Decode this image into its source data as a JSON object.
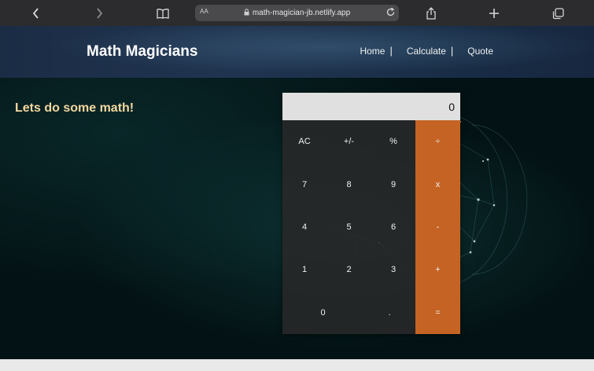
{
  "browser": {
    "text_size_label": "AA",
    "url": "math-magician-jb.netlify.app"
  },
  "header": {
    "logo": "Math Magicians",
    "nav": [
      {
        "label": "Home",
        "separator": "|"
      },
      {
        "label": "Calculate",
        "separator": "|"
      },
      {
        "label": "Quote",
        "separator": ""
      }
    ]
  },
  "main": {
    "heading": "Lets do some math!"
  },
  "calculator": {
    "display": "0",
    "keys": {
      "ac": "AC",
      "sign": "+/-",
      "percent": "%",
      "divide": "÷",
      "seven": "7",
      "eight": "8",
      "nine": "9",
      "multiply": "x",
      "four": "4",
      "five": "5",
      "six": "6",
      "minus": "-",
      "one": "1",
      "two": "2",
      "three": "3",
      "plus": "+",
      "zero": "0",
      "dot": ".",
      "equals": "="
    }
  },
  "colors": {
    "accent_orange": "#d66a24",
    "heading_text": "#f3d8a0",
    "header_bg": "#1b2c45",
    "display_bg": "#e0e0e0"
  }
}
